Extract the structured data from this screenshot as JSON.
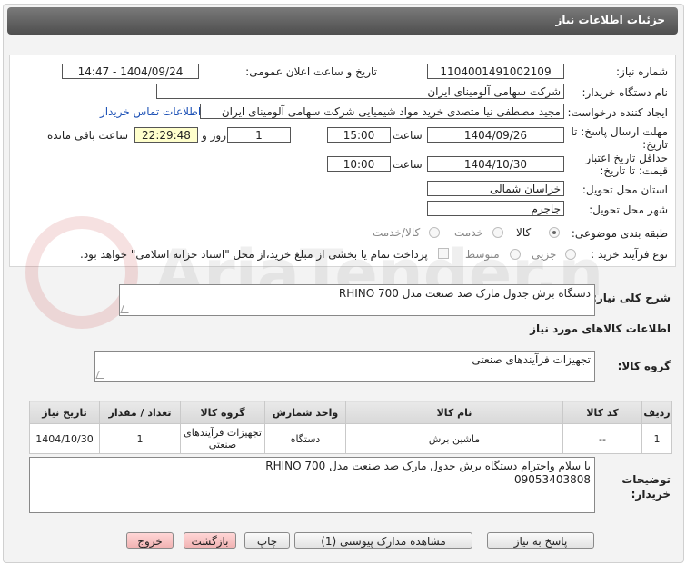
{
  "header": {
    "title": "جزئیات اطلاعات نیاز"
  },
  "form": {
    "need_number_label": "شماره نیاز:",
    "need_number": "1104001491002109",
    "announce_label": "تاریخ و ساعت اعلان عمومی:",
    "announce_value": "1404/09/24 - 14:47",
    "buyer_org_label": "نام دستگاه خریدار:",
    "buyer_org": "شرکت سهامی آلومینای ایران",
    "requester_label": "ایجاد کننده درخواست:",
    "requester": "مجید مصطفی نیا متصدی خرید مواد شیمیایی شرکت سهامی آلومینای ایران",
    "contact_link": "اطلاعات تماس خریدار",
    "reply_deadline_label": "مهلت ارسال پاسخ: تا تاریخ:",
    "reply_date": "1404/09/26",
    "hour_label": "ساعت",
    "reply_time": "15:00",
    "days_value": "1",
    "days_label": "روز و",
    "remaining_time": "22:29:48",
    "remaining_label": "ساعت باقی مانده",
    "price_validity_label": "حداقل تاریخ اعتبار قیمت: تا تاریخ:",
    "validity_date": "1404/10/30",
    "validity_hour_label": "ساعت",
    "validity_time": "10:00",
    "province_label": "استان محل تحویل:",
    "province": "خراسان شمالی",
    "city_label": "شهر محل تحویل:",
    "city": "جاجرم",
    "category_label": "طبقه بندی موضوعی:",
    "category_options": [
      "کالا",
      "خدمت",
      "کالا/خدمت"
    ],
    "process_label": "نوع فرآیند خرید :",
    "process_options": [
      "جزیی",
      "متوسط"
    ],
    "payment_note": "پرداخت تمام یا بخشی از مبلغ خرید،از محل \"اسناد خزانه اسلامی\" خواهد بود."
  },
  "description": {
    "label": "شرح کلی نیاز:",
    "text": "دستگاه  برش جدول مارک صد صنعت مدل RHINO 700"
  },
  "goods_info_title": "اطلاعات کالاهای مورد نیاز",
  "goods_group": {
    "label": "گروه کالا:",
    "value": "تجهیزات فرآیندهای صنعتی"
  },
  "table": {
    "headers": [
      "ردیف",
      "کد کالا",
      "نام کالا",
      "واحد شمارش",
      "گروه کالا",
      "تعداد / مقدار",
      "تاریخ نیاز"
    ],
    "row": {
      "index": "1",
      "code": "--",
      "name": "ماشین برش",
      "unit": "دستگاه",
      "group": "تجهیزات فرآیندهای صنعتی",
      "qty": "1",
      "date": "1404/10/30"
    }
  },
  "buyer_notes": {
    "label": "توضیحات خریدار:",
    "line1": "با سلام واحترام دستگاه  برش جدول مارک صد صنعت مدل RHINO 700",
    "line2": "09053403808"
  },
  "buttons": {
    "reply": "پاسخ به نیاز",
    "attachments": "مشاهده مدارک پیوستی (1)",
    "print": "چاپ",
    "back": "بازگشت",
    "exit": "خروج"
  },
  "watermark_text": "AriaTender.neT"
}
